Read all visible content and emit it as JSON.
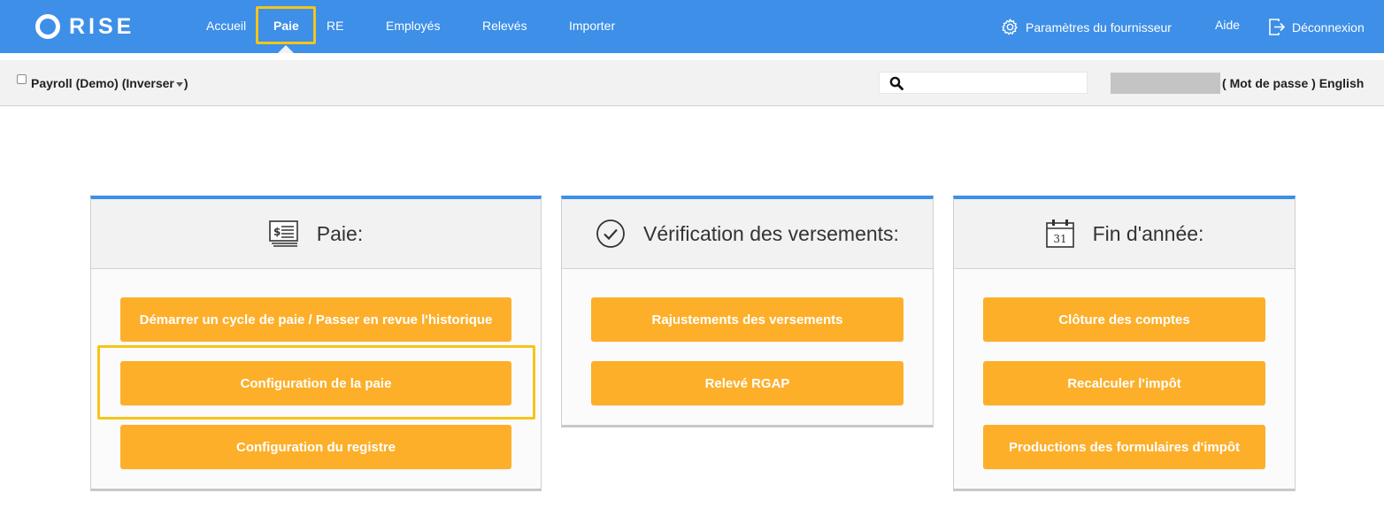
{
  "app": {
    "logo_text": "RISE"
  },
  "nav": {
    "items": [
      {
        "label": "Accueil"
      },
      {
        "label": "Paie"
      },
      {
        "label": "RE"
      },
      {
        "label": "Employés"
      },
      {
        "label": "Relevés"
      },
      {
        "label": "Importer"
      }
    ],
    "active": "Paie",
    "right": {
      "supplier_settings": "Paramètres du fournisseur",
      "help": "Aide",
      "logout": "Déconnexion"
    }
  },
  "subbar": {
    "company": "Payroll (Demo)",
    "switch_open": "(",
    "switch_label": "Inverser",
    "switch_close": ")",
    "search": {
      "value": "",
      "placeholder": ""
    },
    "account": {
      "open_paren": "(",
      "password_label": "Mot de passe",
      "close_paren": ")",
      "language_label": "English"
    }
  },
  "cards": [
    {
      "title": "Paie:",
      "icon": "payroll-icon",
      "buttons": [
        {
          "label": "Démarrer un cycle de paie / Passer en revue l'historique"
        },
        {
          "label": "Configuration de la paie"
        },
        {
          "label": "Configuration du registre"
        }
      ]
    },
    {
      "title": "Vérification des versements:",
      "icon": "check-circle-icon",
      "buttons": [
        {
          "label": "Rajustements des versements"
        },
        {
          "label": "Relevé RGAP"
        }
      ]
    },
    {
      "title": "Fin d'année:",
      "icon": "calendar-icon",
      "calendar_day": "31",
      "buttons": [
        {
          "label": "Clôture des comptes"
        },
        {
          "label": "Recalculer l'impôt"
        },
        {
          "label": "Productions des formulaires d'impôt"
        }
      ]
    }
  ],
  "colors": {
    "nav_bg": "#3d8fe8",
    "button_bg": "#fdaf2a",
    "highlight": "#f5c518",
    "subbar_bg": "#f2f2f2"
  }
}
